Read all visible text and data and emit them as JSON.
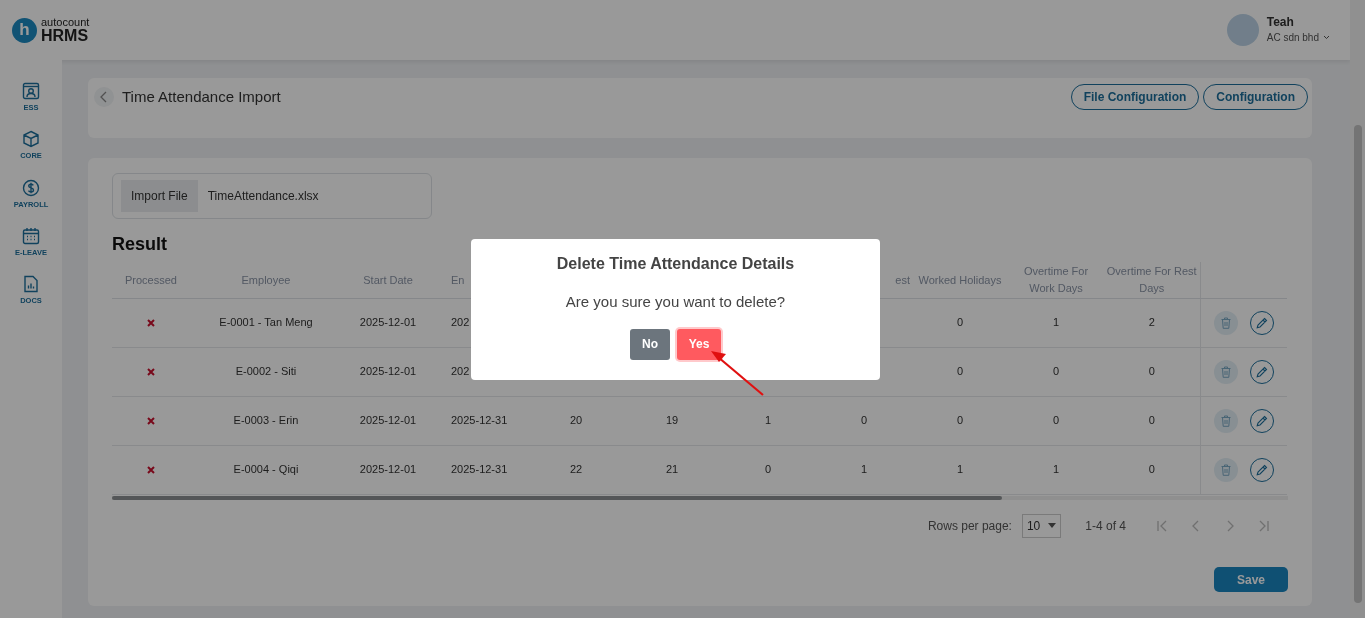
{
  "header": {
    "logo": {
      "mark": "h",
      "brand": "autocount",
      "product": "HRMS"
    },
    "user": {
      "name": "Teah",
      "company": "AC sdn bhd"
    }
  },
  "sidebar": {
    "items": [
      {
        "label": "ESS",
        "kind": "ess"
      },
      {
        "label": "CORE",
        "kind": "core"
      },
      {
        "label": "PAYROLL",
        "kind": "payroll"
      },
      {
        "label": "E-LEAVE",
        "kind": "leave"
      },
      {
        "label": "DOCS",
        "kind": "docs"
      }
    ]
  },
  "page": {
    "title": "Time Attendance Import",
    "buttons": [
      "File Configuration",
      "Configuration"
    ]
  },
  "import": {
    "button": "Import File",
    "file_name": "TimeAttendance.xlsx"
  },
  "result": {
    "title": "Result",
    "table": {
      "headers": {
        "processed": "Processed",
        "employee": "Employee",
        "start_date": "Start Date",
        "end_date": "En",
        "column_8": "est",
        "worked_holidays": "Worked Holidays",
        "overtime_work_days": "Overtime For Work Days",
        "overtime_rest_days": "Overtime For Rest Days"
      },
      "rows": [
        {
          "processed": false,
          "employee": "E-0001 - Tan Meng",
          "start_date": "2025-12-01",
          "end_date": "202",
          "worked_holidays": "0",
          "overtime_work_days": "1",
          "overtime_rest_days": "2"
        },
        {
          "processed": false,
          "employee": "E-0002 - Siti",
          "start_date": "2025-12-01",
          "end_date": "202",
          "worked_holidays": "0",
          "overtime_work_days": "0",
          "overtime_rest_days": "0"
        },
        {
          "processed": false,
          "employee": "E-0003 - Erin",
          "start_date": "2025-12-01",
          "end_date": "2025-12-31",
          "column_5": "20",
          "column_6": "19",
          "column_7": "1",
          "column_8": "0",
          "worked_holidays": "0",
          "overtime_work_days": "0",
          "overtime_rest_days": "0"
        },
        {
          "processed": false,
          "employee": "E-0004 - Qiqi",
          "start_date": "2025-12-01",
          "end_date": "2025-12-31",
          "column_5": "22",
          "column_6": "21",
          "column_7": "0",
          "column_8": "1",
          "worked_holidays": "1",
          "overtime_work_days": "1",
          "overtime_rest_days": "0"
        }
      ]
    },
    "pagination": {
      "rows_per_page_label": "Rows per page:",
      "rows_per_page": "10",
      "range": "1-4 of 4"
    }
  },
  "save_button": "Save",
  "dialog": {
    "title": "Delete Time Attendance Details",
    "message": "Are you sure you want to delete?",
    "buttons": [
      {
        "label": "No",
        "kind": "cancel",
        "focused": false
      },
      {
        "label": "Yes",
        "kind": "confirm",
        "focused": true
      }
    ]
  }
}
